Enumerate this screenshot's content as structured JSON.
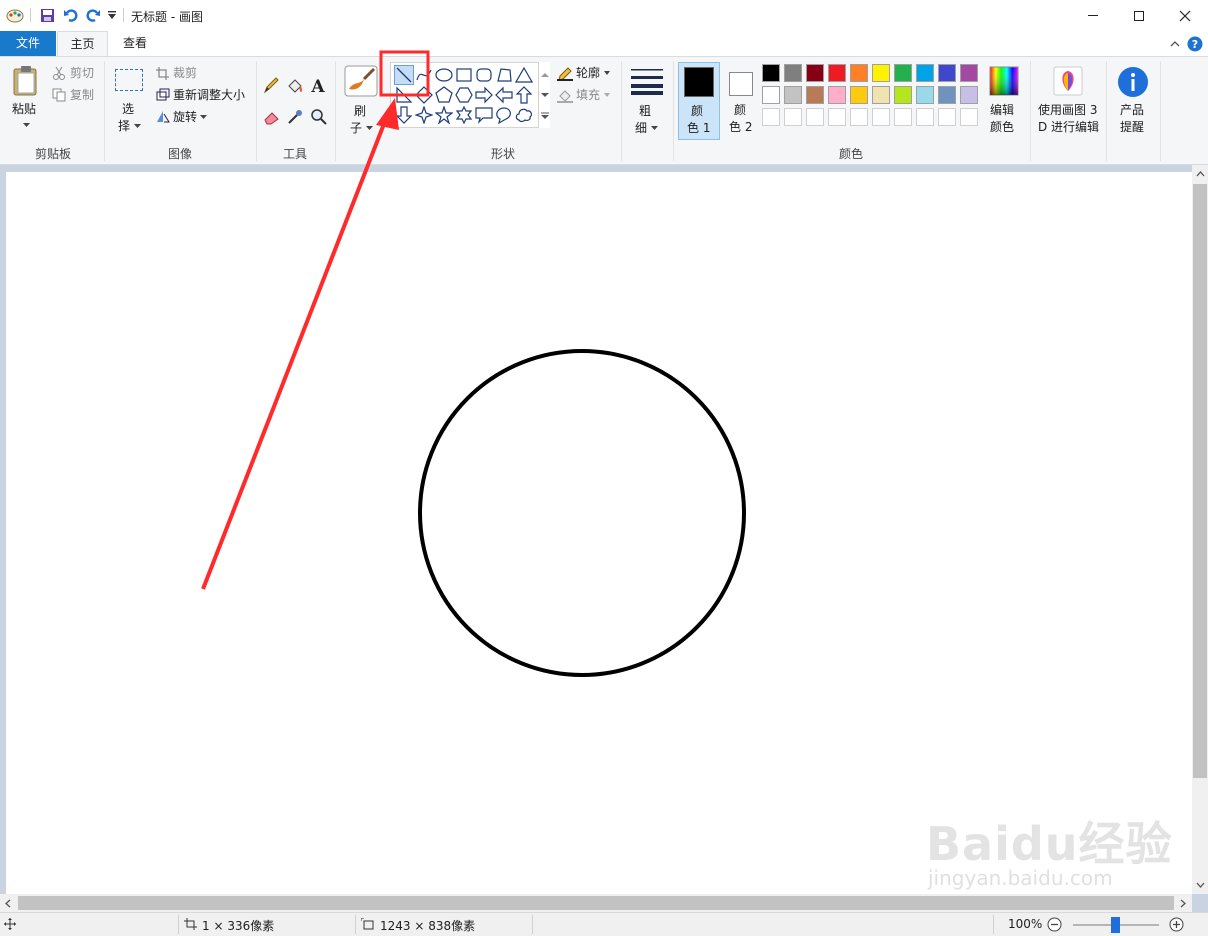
{
  "title": {
    "doc_title": "无标题 - 画图"
  },
  "menu_tabs": {
    "file": "文件",
    "home": "主页",
    "view": "查看"
  },
  "clipboard": {
    "paste": "粘贴",
    "cut": "剪切",
    "copy": "复制",
    "group": "剪贴板"
  },
  "image": {
    "select1": "选",
    "select2": "择",
    "crop": "裁剪",
    "resize": "重新调整大小",
    "rotate": "旋转",
    "group": "图像"
  },
  "tools": {
    "group": "工具"
  },
  "brush": {
    "l1": "刷",
    "l2": "子"
  },
  "shapes": {
    "outline": "轮廓",
    "fill": "填充",
    "group": "形状"
  },
  "size": {
    "l1": "粗",
    "l2": "细"
  },
  "colors": {
    "c1a": "颜",
    "c1b": "色 1",
    "c2a": "颜",
    "c2b": "色 2",
    "edit1": "编辑",
    "edit2": "颜色",
    "group": "颜色",
    "color1": "#000000",
    "color2": "#ffffff",
    "palette_row1": [
      "#000000",
      "#7f7f7f",
      "#880015",
      "#ed1c24",
      "#ff7f27",
      "#fff200",
      "#22b14c",
      "#00a2e8",
      "#3f48cc",
      "#a349a4"
    ],
    "palette_row2": [
      "#ffffff",
      "#c3c3c3",
      "#b97a57",
      "#ffaec9",
      "#ffc90e",
      "#efe4b0",
      "#b5e61d",
      "#99d9ea",
      "#7092be",
      "#c8bfe7"
    ]
  },
  "paint3d": {
    "l1": "使用画图 3",
    "l2": "D 进行编辑"
  },
  "product": {
    "l1": "产品",
    "l2": "提醒"
  },
  "status": {
    "cursor_pos": "1 × 336像素",
    "canvas_size": "1243 × 838像素",
    "zoom": "100%"
  },
  "watermark": {
    "brand": "Baidu经验",
    "url": "jingyan.baidu.com"
  },
  "annotation_color": "#ff2a2a"
}
